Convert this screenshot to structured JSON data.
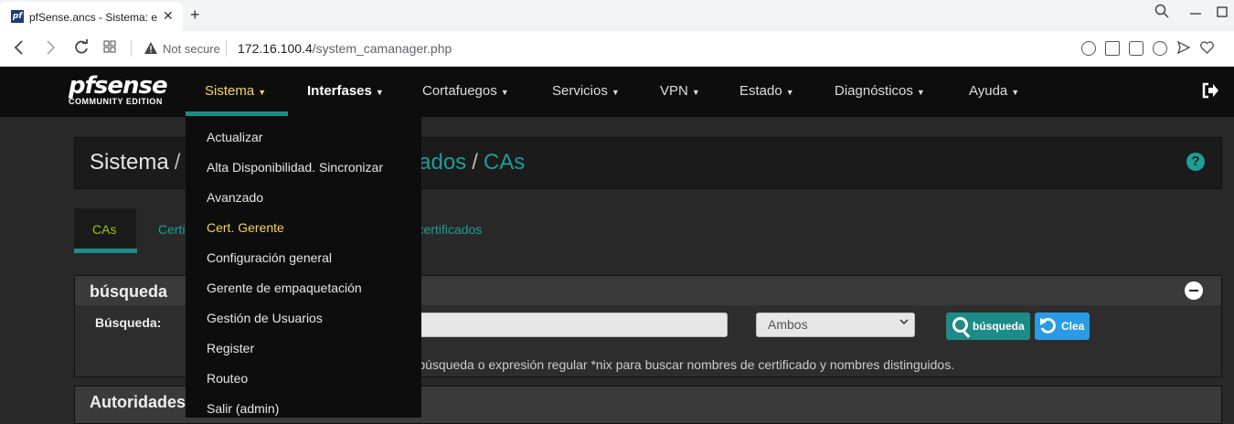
{
  "browser": {
    "tab_title": "pfSense.ancs - Sistema: el a",
    "tab_favicon": "pf",
    "new_tab_symbol": "+",
    "not_secure_label": "Not secure",
    "url_host": "172.16.100.4",
    "url_path": "/system_camanager.php"
  },
  "logo": {
    "main": "pfsense",
    "sub": "COMMUNITY EDITION"
  },
  "navbar": {
    "items": [
      {
        "label": "Sistema"
      },
      {
        "label": "Interfases"
      },
      {
        "label": "Cortafuegos"
      },
      {
        "label": "Servicios"
      },
      {
        "label": "VPN"
      },
      {
        "label": "Estado"
      },
      {
        "label": "Diagnósticos"
      },
      {
        "label": "Ayuda"
      }
    ],
    "active_color": "#f4d55b"
  },
  "breadcrumb": {
    "root": "Sistema",
    "middle": "Cert. Gerente de certificados",
    "current": "CAs"
  },
  "subtabs": {
    "cas": "CAs",
    "certificates": "Certificados",
    "revocation": "Revocación de certificados"
  },
  "search_panel": {
    "title": "búsqueda",
    "label": "Búsqueda:",
    "select_value": "Ambos",
    "search_button": "búsqueda",
    "clear_button": "Clea",
    "help_text": "Introduce la cadena de búsqueda o expresión regular *nix para buscar nombres de certificado y nombres distinguidos."
  },
  "ca_panel": {
    "title": "Autoridades de Certificación"
  },
  "dropdown": {
    "items": [
      {
        "label": "Actualizar"
      },
      {
        "label": "Alta Disponibilidad. Sincronizar"
      },
      {
        "label": "Avanzado"
      },
      {
        "label": "Cert. Gerente"
      },
      {
        "label": "Configuración general"
      },
      {
        "label": "Gerente de empaquetación"
      },
      {
        "label": "Gestión de Usuarios"
      },
      {
        "label": "Register"
      },
      {
        "label": "Routeo"
      },
      {
        "label": "Salir (admin)"
      }
    ]
  },
  "colors": {
    "accent_teal": "#1d8b87",
    "link_teal": "#1d9e96",
    "active_yellow": "#f4d55b",
    "tab_green": "#9bc31c",
    "clear_blue": "#2b9be5"
  }
}
